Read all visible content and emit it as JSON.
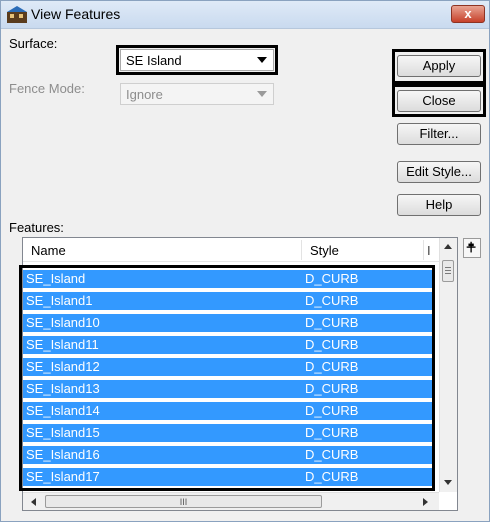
{
  "window": {
    "title": "View Features",
    "close_glyph": "x"
  },
  "surface": {
    "label": "Surface:",
    "value": "SE Island"
  },
  "fence_mode": {
    "label": "Fence Mode:",
    "value": "Ignore"
  },
  "buttons": {
    "apply": "Apply",
    "close": "Close",
    "filter": "Filter...",
    "edit_style": "Edit Style...",
    "help": "Help"
  },
  "features": {
    "label": "Features:",
    "columns": [
      "Name",
      "Style",
      "I"
    ],
    "rows": [
      {
        "name": "SE_Island",
        "style": "D_CURB"
      },
      {
        "name": "SE_Island1",
        "style": "D_CURB"
      },
      {
        "name": "SE_Island10",
        "style": "D_CURB"
      },
      {
        "name": "SE_Island11",
        "style": "D_CURB"
      },
      {
        "name": "SE_Island12",
        "style": "D_CURB"
      },
      {
        "name": "SE_Island13",
        "style": "D_CURB"
      },
      {
        "name": "SE_Island14",
        "style": "D_CURB"
      },
      {
        "name": "SE_Island15",
        "style": "D_CURB"
      },
      {
        "name": "SE_Island16",
        "style": "D_CURB"
      },
      {
        "name": "SE_Island17",
        "style": "D_CURB"
      }
    ],
    "scroll_glyph": "III"
  },
  "colors": {
    "selection": "#3399ff",
    "highlight_border": "#000000"
  },
  "icons": {
    "app": "bentley-app-icon",
    "pin": "pin-icon"
  }
}
